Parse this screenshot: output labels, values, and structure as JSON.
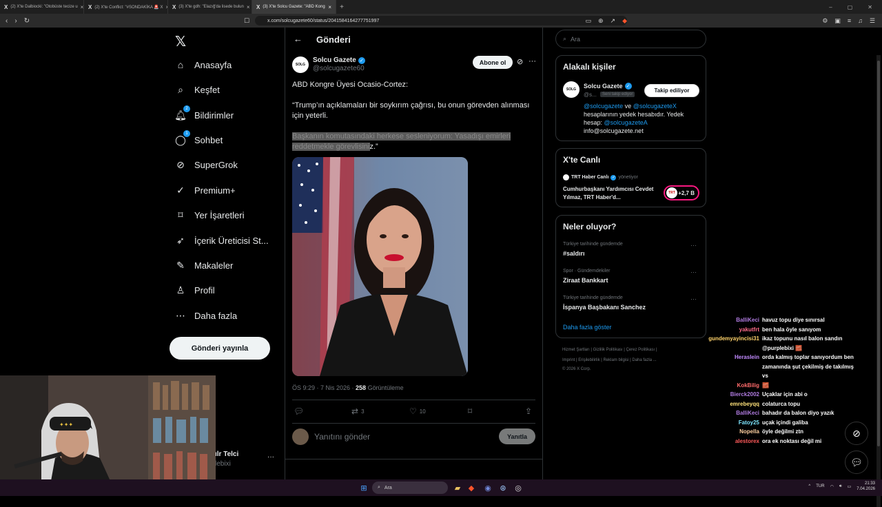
{
  "browser": {
    "tabs": [
      {
        "title": "(2) X'te Dalbiocki: \"Otobüste tecize u"
      },
      {
        "title": "(2) X'te Conflict: \"#SONDAKİKA 🚨 X"
      },
      {
        "title": "(3) X'te gdh: \"Elazığ'da lisede bulun"
      },
      {
        "title": "(3) X'te Solcu Gazete: \"ABD Kong"
      }
    ],
    "url": "x.com/solcugazete60/status/2041584164277751997"
  },
  "nav": {
    "items": [
      {
        "label": "Anasayfa",
        "icon": "home-icon"
      },
      {
        "label": "Keşfet",
        "icon": "search-icon"
      },
      {
        "label": "Bildirimler",
        "icon": "bell-icon",
        "badge": "2"
      },
      {
        "label": "Sohbet",
        "icon": "chat-icon",
        "badge": "1"
      },
      {
        "label": "SuperGrok",
        "icon": "grok-icon"
      },
      {
        "label": "Premium+",
        "icon": "premium-icon"
      },
      {
        "label": "Yer İşaretleri",
        "icon": "bookmark-icon"
      },
      {
        "label": "İçerik Üreticisi St...",
        "icon": "rocket-icon"
      },
      {
        "label": "Makaleler",
        "icon": "article-icon"
      },
      {
        "label": "Profil",
        "icon": "person-icon"
      },
      {
        "label": "Daha fazla",
        "icon": "more-circle-icon"
      }
    ],
    "post_button": "Gönderi yayınla",
    "profile": {
      "name": "ılr Telci",
      "handle": "lebixi"
    }
  },
  "main": {
    "header_title": "Gönderi",
    "author": {
      "avatar_text": "SOLG",
      "name": "Solcu Gazete",
      "handle": "@solcugazete60"
    },
    "subscribe_label": "Abone ol",
    "tweet": {
      "line1": "ABD Kongre Üyesi Ocasio-Cortez:",
      "line2": "“Trump’ın açıklamaları bir soykırım çağrısı, bu onun görevden alınması için yeterli.",
      "line3_highlight": "Başkanın komutasındaki herkese sesleniyorum: Yasadışı emirleri reddetmekle görevlisini",
      "line3_tail": "z.”"
    },
    "meta": {
      "time": "ÖS 9:29 · 7 Nis 2026 · ",
      "views_count": "258",
      "views_label": " Görüntüleme"
    },
    "actions": {
      "replies": "",
      "retweets": "3",
      "likes": "10"
    },
    "reply_placeholder": "Yanıtını gönder",
    "reply_button": "Yanıtla"
  },
  "sidebar": {
    "search_placeholder": "Ara",
    "related": {
      "title": "Alakalı kişiler",
      "avatar_text": "SOLG",
      "name": "Solcu Gazete",
      "handle": "@s...",
      "follows_you": "Seni takip ediyor",
      "follow_button": "Takip ediliyor",
      "bio_link1": "@solcugazete",
      "bio_ve": " ve ",
      "bio_link2": "@solcugazeteX",
      "bio_text": "hesaplarının yedek hesabıdır. Yedek hesap: ",
      "bio_link3": "@solcugazeteA",
      "bio_email": "info@solcugazete.net"
    },
    "live": {
      "title": "X'te Canlı",
      "host": "TRT Haber Canlı",
      "host_role": "yönetiyor",
      "topic": "Cumhurbaşkanı Yardımcısı Cevdet Yılmaz, TRT Haber'd...",
      "listeners": "+2,7 B",
      "avatar_text": "TRT"
    },
    "trends": {
      "title": "Neler oluyor?",
      "items": [
        {
          "context": "Türkiye tarihinde gündemde",
          "name": "#saldırı"
        },
        {
          "context": "Spor · Gündemdekiler",
          "name": "Ziraat Bankkart"
        },
        {
          "context": "Türkiye tarihinde gündemde",
          "name": "İspanya Başbakanı Sanchez"
        }
      ],
      "show_more": "Daha fazla göster"
    },
    "footer": {
      "line1": "Hizmet Şartları  |  Gizlilik Politikası  |  Çerez Politikası  |",
      "line2": "Imprint  |  Erişilebilirlik  |  Reklam bilgisi  |  Daha fazla ...",
      "line3": "© 2026 X Corp."
    }
  },
  "chat": [
    {
      "user": "BalliKeci",
      "msg": "havuz topu diye sınırsal",
      "color": "#b07be0"
    },
    {
      "user": "yakutfrt",
      "msg": "ben hala öyle sanıyom",
      "color": "#ff6b8a"
    },
    {
      "user": "gundemyayincisi31",
      "msg": "ikaz topunu nasıl balon sandın",
      "color": "#ffd36b"
    },
    {
      "user": "",
      "msg": "@purplebixi 🧱",
      "color": "#ffffff"
    },
    {
      "user": "Heraslein",
      "msg": "orda kalmış toplar sanıyordum ben",
      "color": "#c38bff"
    },
    {
      "user": "",
      "msg": "zamanında şut çekilmiş de takılmış",
      "color": "#ffffff"
    },
    {
      "user": "",
      "msg": "vs",
      "color": "#ffffff"
    },
    {
      "user": "KokBilig",
      "msg": "🧱",
      "color": "#ff6b6b"
    },
    {
      "user": "Bierck2002",
      "msg": "Uçaklar için abi o",
      "color": "#b07be0"
    },
    {
      "user": "emrebeyqq",
      "msg": "colaturca topu",
      "color": "#ffe27a"
    },
    {
      "user": "BalliKeci",
      "msg": "bahadır da balon diyo yazık",
      "color": "#b07be0"
    },
    {
      "user": "Fatoy25",
      "msg": "uçak içindi galiba",
      "color": "#7ee6ff"
    },
    {
      "user": "Nopella",
      "msg": "öyle değilmi ztn",
      "color": "#ffd0a0"
    },
    {
      "user": "alestorex",
      "msg": "ora ek noktası değil mi",
      "color": "#ff5a5a"
    }
  ],
  "taskbar": {
    "search": "Ara",
    "lang": "TUR",
    "time": "21:33",
    "date": "7.04.2026"
  }
}
